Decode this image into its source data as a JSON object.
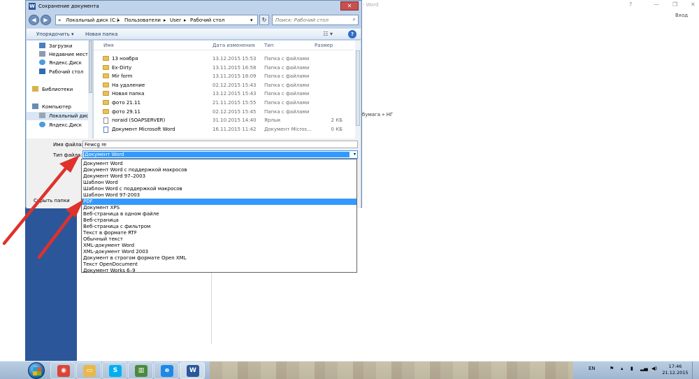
{
  "word": {
    "title": "1 - Word",
    "login": "Вход",
    "doc_snippet": "бумага » НГ",
    "window_controls": [
      "?",
      "—",
      "❐",
      "✕"
    ]
  },
  "dialog": {
    "title": "Сохранение документа",
    "close_label": "✕",
    "address": {
      "crumbs": [
        "«",
        "Локальный диск (C:)",
        "▸",
        "Пользователи",
        "▸",
        "User",
        "▸",
        "Рабочий стол"
      ],
      "dropdown_arrow": "▾"
    },
    "search_placeholder": "Поиск: Рабочий стол",
    "toolbar": {
      "organize": "Упорядочить ▾",
      "new_folder": "Новая папка",
      "view_icon": "☷ ▾",
      "help": "?"
    },
    "nav_items": [
      {
        "label": "Загрузки",
        "icon": "downloads-icon"
      },
      {
        "label": "Недавние места",
        "icon": "recent-places-icon"
      },
      {
        "label": "Яндекс.Диск",
        "icon": "yandex-disk-icon"
      },
      {
        "label": "Рабочий стол",
        "icon": "desktop-icon"
      },
      {
        "label": "Библиотеки",
        "icon": "libraries-icon"
      },
      {
        "label": "Компьютер",
        "icon": "computer-icon"
      },
      {
        "label": "Локальный диск",
        "icon": "local-disk-icon"
      },
      {
        "label": "Яндекс.Диск",
        "icon": "yandex-disk-icon"
      }
    ],
    "columns": {
      "name": "Имя",
      "date": "Дата изменения",
      "type": "Тип",
      "size": "Размер"
    },
    "files": [
      {
        "name": "13 ноября",
        "date": "13.12.2015 15:53",
        "type": "Папка с файлами",
        "size": "",
        "kind": "folder"
      },
      {
        "name": "Ex-Dirty",
        "date": "13.11.2015 16:58",
        "type": "Папка с файлами",
        "size": "",
        "kind": "folder"
      },
      {
        "name": "Mir form",
        "date": "13.11.2015 18:09",
        "type": "Папка с файлами",
        "size": "",
        "kind": "folder"
      },
      {
        "name": "На удаление",
        "date": "02.12.2015 15:43",
        "type": "Папка с файлами",
        "size": "",
        "kind": "folder"
      },
      {
        "name": "Новая папка",
        "date": "13.12.2015 15:43",
        "type": "Папка с файлами",
        "size": "",
        "kind": "folder"
      },
      {
        "name": "фото 21.11",
        "date": "21.11.2015 15:55",
        "type": "Папка с файлами",
        "size": "",
        "kind": "folder"
      },
      {
        "name": "фото 29.11",
        "date": "02.12.2015 15:45",
        "type": "Папка с файлами",
        "size": "",
        "kind": "folder"
      },
      {
        "name": "noraid (SOAPSERVER)",
        "date": "31.10.2015 14:40",
        "type": "Ярлык",
        "size": "2 КБ",
        "kind": "shortcut"
      },
      {
        "name": "Документ Microsoft Word",
        "date": "16.11.2015 11:42",
        "type": "Документ Micros...",
        "size": "0 КБ",
        "kind": "doc"
      }
    ],
    "filename_label": "Имя файла:",
    "filename_value": "Fewcg re",
    "filetype_label": "Тип файла:",
    "filetype_value": "Документ Word",
    "select_arrow": "▾",
    "hide_folders": "Скрыть папки",
    "filetype_options": [
      "Документ Word",
      "Документ Word с поддержкой макросов",
      "Документ Word 97–2003",
      "Шаблон Word",
      "Шаблон Word с поддержкой макросов",
      "Шаблон Word 97-2003",
      "PDF",
      "Документ XPS",
      "Веб-страница в одном файле",
      "Веб-страница",
      "Веб-страница с фильтром",
      "Текст в формате RTF",
      "Обычный текст",
      "XML-документ Word",
      "XML-документ Word 2003",
      "Документ в строгом формате Open XML",
      "Текст OpenDocument",
      "Документ Works 6–9"
    ],
    "highlighted_option": 6
  },
  "taskbar": {
    "lang": "EN",
    "time": "17:46",
    "date": "21.12.2015",
    "apps": [
      {
        "name": "chrome-icon",
        "glyph": "◉",
        "color": "#db4437"
      },
      {
        "name": "file-explorer-icon",
        "glyph": "▭",
        "color": "#e8b84a"
      },
      {
        "name": "skype-icon",
        "glyph": "S",
        "color": "#00aff0"
      },
      {
        "name": "chart-app-icon",
        "glyph": "▥",
        "color": "#4a8a3c"
      },
      {
        "name": "internet-explorer-icon",
        "glyph": "e",
        "color": "#1e88e5"
      },
      {
        "name": "word-icon",
        "glyph": "W",
        "color": "#2b579a"
      }
    ]
  },
  "colors": {
    "word_blue": "#2b579a",
    "arrow_red": "#e0312b",
    "selection_blue": "#3399ff"
  }
}
